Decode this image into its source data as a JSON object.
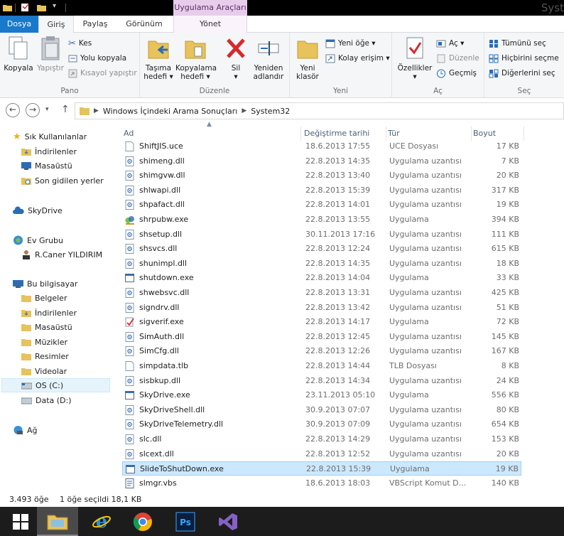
{
  "window": {
    "tools_tab": "Uygulama Araçları",
    "title": "Syst"
  },
  "tabs": {
    "file": "Dosya",
    "home": "Giriş",
    "share": "Paylaş",
    "view": "Görünüm",
    "manage": "Yönet"
  },
  "ribbon": {
    "copy": "Kopyala",
    "paste": "Yapıştır",
    "cut": "Kes",
    "copy_path": "Yolu kopyala",
    "paste_shortcut": "Kısayol yapıştır",
    "group_clipboard": "Pano",
    "move_to_1": "Taşıma",
    "move_to_2": "hedefi ▾",
    "copy_to_1": "Kopyalama",
    "copy_to_2": "hedefi ▾",
    "delete_1": "Sil",
    "delete_2": "▾",
    "rename_1": "Yeniden",
    "rename_2": "adlandır",
    "group_organize": "Düzenle",
    "new_folder_1": "Yeni",
    "new_folder_2": "klasör",
    "new_item": "Yeni öğe ▾",
    "easy_access": "Kolay erişim ▾",
    "group_new": "Yeni",
    "properties_1": "Özellikler",
    "properties_2": "▾",
    "open": "Aç ▾",
    "edit": "Düzenle",
    "history": "Geçmiş",
    "group_open": "Aç",
    "select_all": "Tümünü seç",
    "select_none": "Hiçbirini seçme",
    "invert_selection": "Diğerlerini seç",
    "group_select": "Seç"
  },
  "address": {
    "crumb1": "Windows İçindeki Arama Sonuçları",
    "crumb2": "System32"
  },
  "nav": {
    "favorites": "Sık Kullanılanlar",
    "downloads": "İndirilenler",
    "desktop": "Masaüstü",
    "recent": "Son gidilen yerler",
    "skydrive": "SkyDrive",
    "homegroup": "Ev Grubu",
    "user": "R.Caner YILDIRIM",
    "thispc": "Bu bilgisayar",
    "documents": "Belgeler",
    "downloads2": "İndirilenler",
    "desktop2": "Masaüstü",
    "music": "Müzikler",
    "pictures": "Resimler",
    "videos": "Videolar",
    "os": "OS (C:)",
    "data": "Data (D:)",
    "network": "Ağ"
  },
  "columns": {
    "name": "Ad",
    "date": "Değiştirme tarihi",
    "type": "Tür",
    "size": "Boyut"
  },
  "files": [
    {
      "name": "ShiftJIS.uce",
      "date": "18.6.2013 17:55",
      "type": "UCE Dosyası",
      "size": "17 KB",
      "icon": "file-icon"
    },
    {
      "name": "shimeng.dll",
      "date": "22.8.2013 14:35",
      "type": "Uygulama uzantısı",
      "size": "7 KB",
      "icon": "dll-icon"
    },
    {
      "name": "shimgvw.dll",
      "date": "22.8.2013 13:40",
      "type": "Uygulama uzantısı",
      "size": "20 KB",
      "icon": "dll-icon"
    },
    {
      "name": "shlwapi.dll",
      "date": "22.8.2013 15:39",
      "type": "Uygulama uzantısı",
      "size": "317 KB",
      "icon": "dll-icon"
    },
    {
      "name": "shpafact.dll",
      "date": "22.8.2013 14:01",
      "type": "Uygulama uzantısı",
      "size": "19 KB",
      "icon": "dll-icon"
    },
    {
      "name": "shrpubw.exe",
      "date": "22.8.2013 13:55",
      "type": "Uygulama",
      "size": "394 KB",
      "icon": "share-exe-icon"
    },
    {
      "name": "shsetup.dll",
      "date": "30.11.2013 17:16",
      "type": "Uygulama uzantısı",
      "size": "111 KB",
      "icon": "dll-icon"
    },
    {
      "name": "shsvcs.dll",
      "date": "22.8.2013 12:24",
      "type": "Uygulama uzantısı",
      "size": "615 KB",
      "icon": "dll-icon"
    },
    {
      "name": "shunimpl.dll",
      "date": "22.8.2013 14:35",
      "type": "Uygulama uzantısı",
      "size": "18 KB",
      "icon": "dll-icon"
    },
    {
      "name": "shutdown.exe",
      "date": "22.8.2013 14:04",
      "type": "Uygulama",
      "size": "33 KB",
      "icon": "exe-icon"
    },
    {
      "name": "shwebsvc.dll",
      "date": "22.8.2013 13:31",
      "type": "Uygulama uzantısı",
      "size": "425 KB",
      "icon": "dll-icon"
    },
    {
      "name": "signdrv.dll",
      "date": "22.8.2013 13:42",
      "type": "Uygulama uzantısı",
      "size": "51 KB",
      "icon": "dll-icon"
    },
    {
      "name": "sigverif.exe",
      "date": "22.8.2013 14:17",
      "type": "Uygulama",
      "size": "72 KB",
      "icon": "sigverif-icon"
    },
    {
      "name": "SimAuth.dll",
      "date": "22.8.2013 12:45",
      "type": "Uygulama uzantısı",
      "size": "145 KB",
      "icon": "dll-icon"
    },
    {
      "name": "SimCfg.dll",
      "date": "22.8.2013 12:26",
      "type": "Uygulama uzantısı",
      "size": "167 KB",
      "icon": "dll-icon"
    },
    {
      "name": "simpdata.tlb",
      "date": "22.8.2013 14:44",
      "type": "TLB Dosyası",
      "size": "8 KB",
      "icon": "file-icon"
    },
    {
      "name": "sisbkup.dll",
      "date": "22.8.2013 14:34",
      "type": "Uygulama uzantısı",
      "size": "24 KB",
      "icon": "dll-icon"
    },
    {
      "name": "SkyDrive.exe",
      "date": "23.11.2013 05:10",
      "type": "Uygulama",
      "size": "556 KB",
      "icon": "exe-icon"
    },
    {
      "name": "SkyDriveShell.dll",
      "date": "30.9.2013 07:07",
      "type": "Uygulama uzantısı",
      "size": "80 KB",
      "icon": "dll-icon"
    },
    {
      "name": "SkyDriveTelemetry.dll",
      "date": "30.9.2013 07:09",
      "type": "Uygulama uzantısı",
      "size": "654 KB",
      "icon": "dll-icon"
    },
    {
      "name": "slc.dll",
      "date": "22.8.2013 14:29",
      "type": "Uygulama uzantısı",
      "size": "153 KB",
      "icon": "dll-icon"
    },
    {
      "name": "slcext.dll",
      "date": "22.8.2013 12:52",
      "type": "Uygulama uzantısı",
      "size": "20 KB",
      "icon": "dll-icon"
    },
    {
      "name": "SlideToShutDown.exe",
      "date": "22.8.2013 15:39",
      "type": "Uygulama",
      "size": "19 KB",
      "icon": "exe-icon",
      "selected": true
    },
    {
      "name": "slmgr.vbs",
      "date": "18.6.2013 18:03",
      "type": "VBScript Komut D...",
      "size": "140 KB",
      "icon": "script-icon"
    }
  ],
  "status": {
    "count": "3.493 öğe",
    "selection": "1 öğe seçildi  18,1 KB"
  },
  "colors": {
    "file_tab": "#1979ca",
    "tools_tab": "#e8cdeb",
    "selection": "#cce8ff",
    "taskbar": "#1c1c1c"
  }
}
